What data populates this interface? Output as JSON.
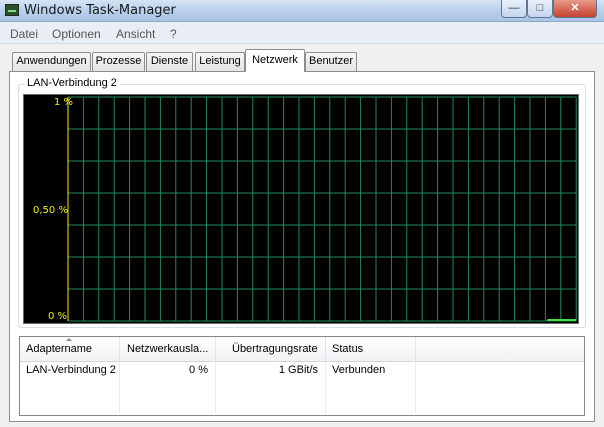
{
  "window": {
    "title": "Windows Task-Manager",
    "buttons": {
      "minimize": "—",
      "maximize": "□",
      "close": "✕"
    }
  },
  "menu": [
    "Datei",
    "Optionen",
    "Ansicht",
    "?"
  ],
  "tabs": [
    "Anwendungen",
    "Prozesse",
    "Dienste",
    "Leistung",
    "Netzwerk",
    "Benutzer"
  ],
  "active_tab": "Netzwerk",
  "graph": {
    "label": "LAN-Verbindung 2",
    "y_labels": {
      "top": "1 %",
      "mid": "0,50 %",
      "bottom": "0 %"
    },
    "grid_color": "#1f8a5a",
    "line_color": "#44dd44",
    "axis_label_color": "#f0f000"
  },
  "adapter_table": {
    "columns": [
      "Adaptername",
      "Netzwerkausla...",
      "Übertragungsrate",
      "Status"
    ],
    "rows": [
      [
        "LAN-Verbindung 2",
        "0 %",
        "1 GBit/s",
        "Verbunden"
      ]
    ]
  },
  "chart_data": {
    "type": "line",
    "title": "LAN-Verbindung 2",
    "xlabel": "",
    "ylabel": "",
    "yticks": [
      "0 %",
      "0,50 %",
      "1 %"
    ],
    "ylim": [
      0,
      1
    ],
    "grid": true,
    "series": [
      {
        "values": [
          0,
          0,
          0,
          0,
          0,
          0,
          0,
          0,
          0,
          0
        ]
      }
    ]
  }
}
